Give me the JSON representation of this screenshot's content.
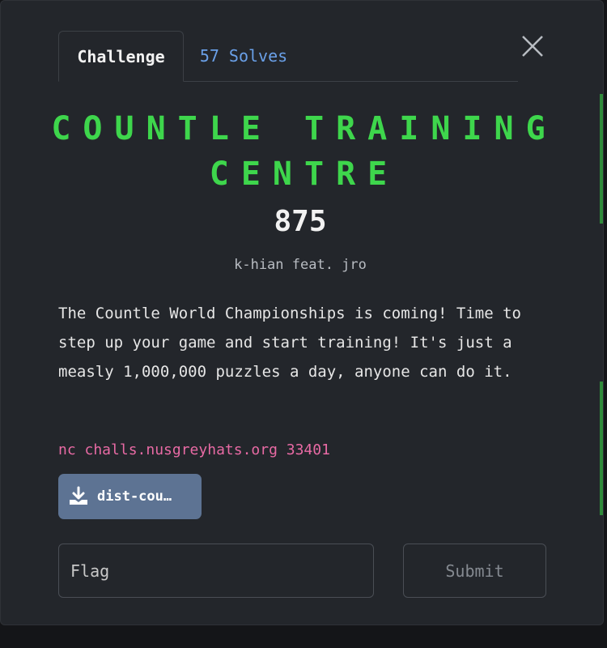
{
  "tabs": {
    "challenge_label": "Challenge",
    "solves_label": "57 Solves"
  },
  "challenge": {
    "title_line1": "COUNTLE TRAINING",
    "title_line2": "CENTRE",
    "points": "875",
    "author": "k-hian feat. jro",
    "description": "The Countle World Championships is coming! Time to step up your game and start training! It's just a measly 1,000,000 puzzles a day, anyone can do it.",
    "connection": "nc challs.nusgreyhats.org 33401",
    "download_label": "dist-cou…"
  },
  "form": {
    "flag_placeholder": "Flag",
    "submit_label": "Submit"
  },
  "colors": {
    "title": "#3ed64c",
    "solves_link": "#6aa0e8",
    "connection": "#e86aa4",
    "download_bg": "#5d7393"
  },
  "icons": {
    "close": "close-icon",
    "download": "download-icon"
  }
}
